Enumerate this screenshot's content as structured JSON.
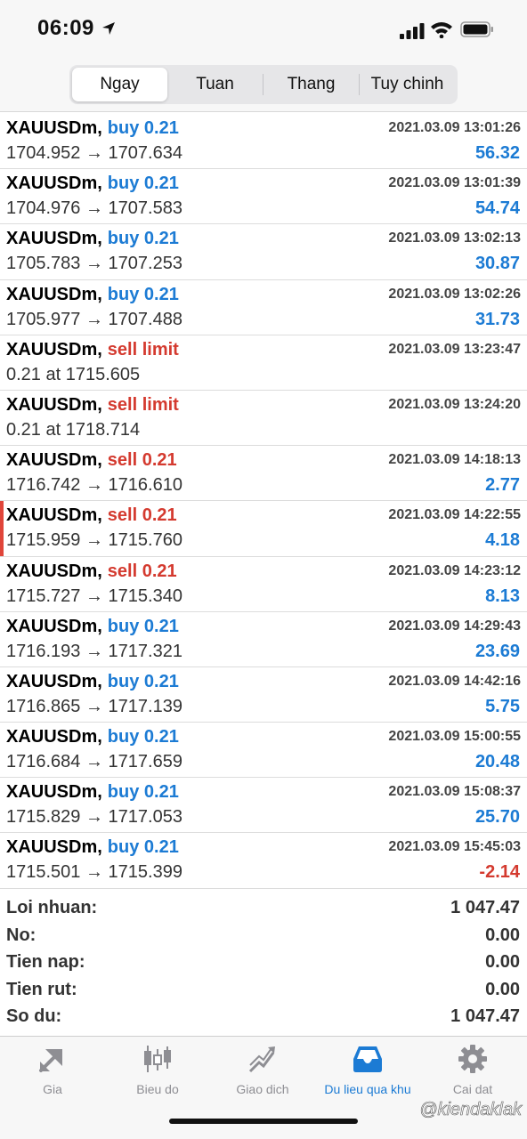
{
  "status_bar": {
    "time": "06:09"
  },
  "segments": [
    "Ngay",
    "Tuan",
    "Thang",
    "Tuy chinh"
  ],
  "trades": [
    {
      "symbol": "XAUUSDm,",
      "action": "buy 0.21",
      "side": "buy",
      "date": "2021.03.09 13:01:26",
      "prices": "1704.952 → 1707.634",
      "profit": "56.32",
      "profit_sign": "pos"
    },
    {
      "symbol": "XAUUSDm,",
      "action": "buy 0.21",
      "side": "buy",
      "date": "2021.03.09 13:01:39",
      "prices": "1704.976 → 1707.583",
      "profit": "54.74",
      "profit_sign": "pos"
    },
    {
      "symbol": "XAUUSDm,",
      "action": "buy 0.21",
      "side": "buy",
      "date": "2021.03.09 13:02:13",
      "prices": "1705.783 → 1707.253",
      "profit": "30.87",
      "profit_sign": "pos"
    },
    {
      "symbol": "XAUUSDm,",
      "action": "buy 0.21",
      "side": "buy",
      "date": "2021.03.09 13:02:26",
      "prices": "1705.977 → 1707.488",
      "profit": "31.73",
      "profit_sign": "pos"
    },
    {
      "symbol": "XAUUSDm,",
      "action": "sell limit",
      "side": "sell",
      "date": "2021.03.09 13:23:47",
      "prices": "0.21 at 1715.605",
      "profit": "",
      "profit_sign": "pos"
    },
    {
      "symbol": "XAUUSDm,",
      "action": "sell limit",
      "side": "sell",
      "date": "2021.03.09 13:24:20",
      "prices": "0.21 at 1718.714",
      "profit": "",
      "profit_sign": "pos"
    },
    {
      "symbol": "XAUUSDm,",
      "action": "sell 0.21",
      "side": "sell",
      "date": "2021.03.09 14:18:13",
      "prices": "1716.742 → 1716.610",
      "profit": "2.77",
      "profit_sign": "pos"
    },
    {
      "symbol": "XAUUSDm,",
      "action": "sell 0.21",
      "side": "sell",
      "date": "2021.03.09 14:22:55",
      "prices": "1715.959 → 1715.760",
      "profit": "4.18",
      "profit_sign": "pos",
      "marked": true
    },
    {
      "symbol": "XAUUSDm,",
      "action": "sell 0.21",
      "side": "sell",
      "date": "2021.03.09 14:23:12",
      "prices": "1715.727 → 1715.340",
      "profit": "8.13",
      "profit_sign": "pos"
    },
    {
      "symbol": "XAUUSDm,",
      "action": "buy 0.21",
      "side": "buy",
      "date": "2021.03.09 14:29:43",
      "prices": "1716.193 → 1717.321",
      "profit": "23.69",
      "profit_sign": "pos"
    },
    {
      "symbol": "XAUUSDm,",
      "action": "buy 0.21",
      "side": "buy",
      "date": "2021.03.09 14:42:16",
      "prices": "1716.865 → 1717.139",
      "profit": "5.75",
      "profit_sign": "pos"
    },
    {
      "symbol": "XAUUSDm,",
      "action": "buy 0.21",
      "side": "buy",
      "date": "2021.03.09 15:00:55",
      "prices": "1716.684 → 1717.659",
      "profit": "20.48",
      "profit_sign": "pos"
    },
    {
      "symbol": "XAUUSDm,",
      "action": "buy 0.21",
      "side": "buy",
      "date": "2021.03.09 15:08:37",
      "prices": "1715.829 → 1717.053",
      "profit": "25.70",
      "profit_sign": "pos"
    },
    {
      "symbol": "XAUUSDm,",
      "action": "buy 0.21",
      "side": "buy",
      "date": "2021.03.09 15:45:03",
      "prices": "1715.501 → 1715.399",
      "profit": "-2.14",
      "profit_sign": "neg"
    }
  ],
  "summary": [
    {
      "label": "Loi nhuan:",
      "value": "1 047.47"
    },
    {
      "label": "No:",
      "value": "0.00"
    },
    {
      "label": "Tien nap:",
      "value": "0.00"
    },
    {
      "label": "Tien rut:",
      "value": "0.00"
    },
    {
      "label": "So du:",
      "value": "1 047.47"
    }
  ],
  "tabs": [
    {
      "label": "Gia",
      "icon": "quotes-arrows-icon"
    },
    {
      "label": "Bieu do",
      "icon": "candlestick-chart-icon"
    },
    {
      "label": "Giao dich",
      "icon": "trade-chart-icon"
    },
    {
      "label": "Du lieu qua khu",
      "icon": "history-inbox-icon",
      "active": true
    },
    {
      "label": "Cai dat",
      "icon": "gear-icon"
    }
  ],
  "watermark": "@kiendaklak",
  "colors": {
    "buy": "#1c7bd4",
    "sell": "#d43a2f",
    "active_tab": "#1c7bd4"
  }
}
